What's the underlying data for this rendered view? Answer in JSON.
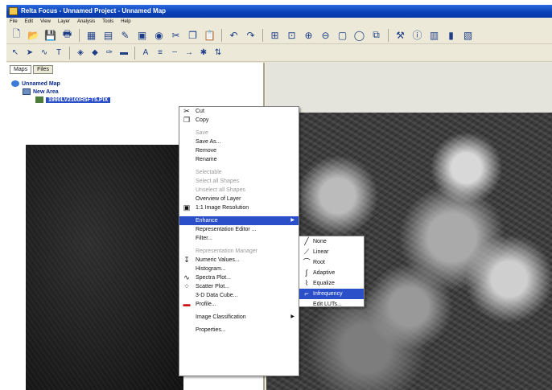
{
  "window": {
    "title": "Relta Focus - Unnamed Project - Unnamed Map"
  },
  "menubar": [
    "File",
    "Edit",
    "View",
    "Layer",
    "Analysis",
    "Tools",
    "Help"
  ],
  "toolbar1": [
    "new-icon",
    "open-icon",
    "save-icon",
    "print-icon",
    "image-icon",
    "chart-icon",
    "brush-icon",
    "monitor-icon",
    "globe-icon",
    "cut-icon",
    "copy-icon",
    "paste-icon",
    "undo-icon",
    "redo-icon",
    "zoom-fit-icon",
    "zoom-window-icon",
    "zoom-in-icon",
    "zoom-out-icon",
    "rectangle-icon",
    "ellipse-icon",
    "layer-add-icon",
    "tools-icon",
    "info-icon",
    "table-icon",
    "histogram-icon",
    "chart-icon"
  ],
  "toolbar2": [
    "pointer-icon",
    "pan-icon",
    "line-icon",
    "text-icon",
    "fill-icon",
    "shapes-icon",
    "pen-icon",
    "color-icon",
    "font-color-icon"
  ],
  "panel": {
    "tabs": [
      "Maps",
      "Files"
    ],
    "tree": {
      "map": "Unnamed Map",
      "area": "New Area",
      "layer": "1990LV2100R5FT5.PIX"
    }
  },
  "context_menu": [
    {
      "label": "Cut",
      "icon": "scissors-icon",
      "enabled": true
    },
    {
      "label": "Copy",
      "icon": "copy-icon",
      "enabled": true
    },
    {
      "label": "Save",
      "enabled": false,
      "gap": true
    },
    {
      "label": "Save As...",
      "enabled": true
    },
    {
      "label": "Remove",
      "enabled": true
    },
    {
      "label": "Rename",
      "enabled": true
    },
    {
      "label": "Selectable",
      "enabled": false,
      "gap": true
    },
    {
      "label": "Select all Shapes",
      "enabled": false
    },
    {
      "label": "Unselect all Shapes",
      "enabled": false
    },
    {
      "label": "Overview of Layer",
      "enabled": true
    },
    {
      "label": "1:1 Image Resolution",
      "icon": "resolution-icon",
      "enabled": true
    },
    {
      "label": "Enhance",
      "enabled": true,
      "highlight": true,
      "submenu": true,
      "gap": true
    },
    {
      "label": "Representation Editor ...",
      "enabled": true
    },
    {
      "label": "Filter...",
      "enabled": true
    },
    {
      "label": "Representation Manager",
      "enabled": false,
      "gap": true
    },
    {
      "label": "Numeric Values...",
      "icon": "numeric-icon",
      "enabled": true
    },
    {
      "label": "Histogram...",
      "enabled": true
    },
    {
      "label": "Spectra Plot...",
      "icon": "spectra-icon",
      "enabled": true
    },
    {
      "label": "Scatter Plot...",
      "icon": "scatter-icon",
      "enabled": true
    },
    {
      "label": "3-D Data Cube...",
      "enabled": true
    },
    {
      "label": "Profile...",
      "icon": "profile-icon",
      "enabled": true
    },
    {
      "label": "Image Classification",
      "enabled": true,
      "submenu": true,
      "gap": true
    },
    {
      "label": "Properties...",
      "enabled": true,
      "gap": true
    }
  ],
  "enhance_submenu": [
    {
      "label": "None",
      "icon": "none-curve-icon"
    },
    {
      "label": "Linear",
      "icon": "linear-curve-icon"
    },
    {
      "label": "Root",
      "icon": "root-curve-icon"
    },
    {
      "label": "Adaptive",
      "icon": "adaptive-curve-icon"
    },
    {
      "label": "Equalize",
      "icon": "equalize-curve-icon"
    },
    {
      "label": "Infrequency",
      "icon": "infrequency-curve-icon",
      "highlight": true
    },
    {
      "label": "Edit LUTs..."
    }
  ]
}
